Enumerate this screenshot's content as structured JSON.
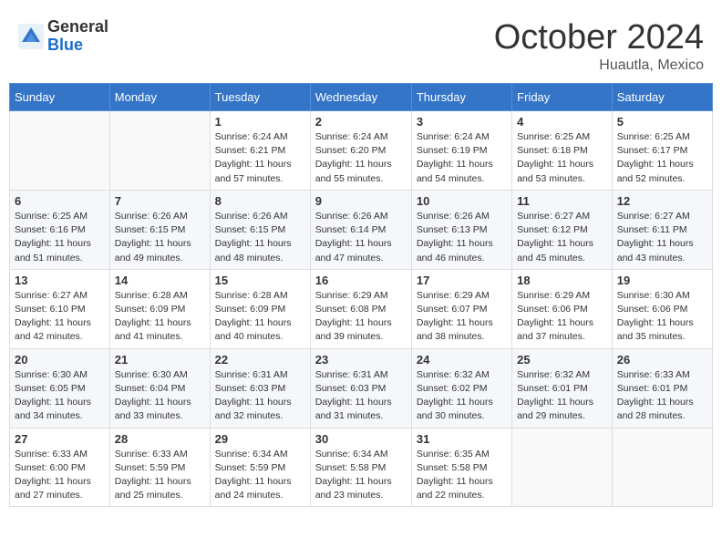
{
  "header": {
    "logo_general": "General",
    "logo_blue": "Blue",
    "month_title": "October 2024",
    "location": "Huautla, Mexico"
  },
  "weekdays": [
    "Sunday",
    "Monday",
    "Tuesday",
    "Wednesday",
    "Thursday",
    "Friday",
    "Saturday"
  ],
  "weeks": [
    [
      {
        "day": "",
        "sunrise": "",
        "sunset": "",
        "daylight": ""
      },
      {
        "day": "",
        "sunrise": "",
        "sunset": "",
        "daylight": ""
      },
      {
        "day": "1",
        "sunrise": "Sunrise: 6:24 AM",
        "sunset": "Sunset: 6:21 PM",
        "daylight": "Daylight: 11 hours and 57 minutes."
      },
      {
        "day": "2",
        "sunrise": "Sunrise: 6:24 AM",
        "sunset": "Sunset: 6:20 PM",
        "daylight": "Daylight: 11 hours and 55 minutes."
      },
      {
        "day": "3",
        "sunrise": "Sunrise: 6:24 AM",
        "sunset": "Sunset: 6:19 PM",
        "daylight": "Daylight: 11 hours and 54 minutes."
      },
      {
        "day": "4",
        "sunrise": "Sunrise: 6:25 AM",
        "sunset": "Sunset: 6:18 PM",
        "daylight": "Daylight: 11 hours and 53 minutes."
      },
      {
        "day": "5",
        "sunrise": "Sunrise: 6:25 AM",
        "sunset": "Sunset: 6:17 PM",
        "daylight": "Daylight: 11 hours and 52 minutes."
      }
    ],
    [
      {
        "day": "6",
        "sunrise": "Sunrise: 6:25 AM",
        "sunset": "Sunset: 6:16 PM",
        "daylight": "Daylight: 11 hours and 51 minutes."
      },
      {
        "day": "7",
        "sunrise": "Sunrise: 6:26 AM",
        "sunset": "Sunset: 6:15 PM",
        "daylight": "Daylight: 11 hours and 49 minutes."
      },
      {
        "day": "8",
        "sunrise": "Sunrise: 6:26 AM",
        "sunset": "Sunset: 6:15 PM",
        "daylight": "Daylight: 11 hours and 48 minutes."
      },
      {
        "day": "9",
        "sunrise": "Sunrise: 6:26 AM",
        "sunset": "Sunset: 6:14 PM",
        "daylight": "Daylight: 11 hours and 47 minutes."
      },
      {
        "day": "10",
        "sunrise": "Sunrise: 6:26 AM",
        "sunset": "Sunset: 6:13 PM",
        "daylight": "Daylight: 11 hours and 46 minutes."
      },
      {
        "day": "11",
        "sunrise": "Sunrise: 6:27 AM",
        "sunset": "Sunset: 6:12 PM",
        "daylight": "Daylight: 11 hours and 45 minutes."
      },
      {
        "day": "12",
        "sunrise": "Sunrise: 6:27 AM",
        "sunset": "Sunset: 6:11 PM",
        "daylight": "Daylight: 11 hours and 43 minutes."
      }
    ],
    [
      {
        "day": "13",
        "sunrise": "Sunrise: 6:27 AM",
        "sunset": "Sunset: 6:10 PM",
        "daylight": "Daylight: 11 hours and 42 minutes."
      },
      {
        "day": "14",
        "sunrise": "Sunrise: 6:28 AM",
        "sunset": "Sunset: 6:09 PM",
        "daylight": "Daylight: 11 hours and 41 minutes."
      },
      {
        "day": "15",
        "sunrise": "Sunrise: 6:28 AM",
        "sunset": "Sunset: 6:09 PM",
        "daylight": "Daylight: 11 hours and 40 minutes."
      },
      {
        "day": "16",
        "sunrise": "Sunrise: 6:29 AM",
        "sunset": "Sunset: 6:08 PM",
        "daylight": "Daylight: 11 hours and 39 minutes."
      },
      {
        "day": "17",
        "sunrise": "Sunrise: 6:29 AM",
        "sunset": "Sunset: 6:07 PM",
        "daylight": "Daylight: 11 hours and 38 minutes."
      },
      {
        "day": "18",
        "sunrise": "Sunrise: 6:29 AM",
        "sunset": "Sunset: 6:06 PM",
        "daylight": "Daylight: 11 hours and 37 minutes."
      },
      {
        "day": "19",
        "sunrise": "Sunrise: 6:30 AM",
        "sunset": "Sunset: 6:06 PM",
        "daylight": "Daylight: 11 hours and 35 minutes."
      }
    ],
    [
      {
        "day": "20",
        "sunrise": "Sunrise: 6:30 AM",
        "sunset": "Sunset: 6:05 PM",
        "daylight": "Daylight: 11 hours and 34 minutes."
      },
      {
        "day": "21",
        "sunrise": "Sunrise: 6:30 AM",
        "sunset": "Sunset: 6:04 PM",
        "daylight": "Daylight: 11 hours and 33 minutes."
      },
      {
        "day": "22",
        "sunrise": "Sunrise: 6:31 AM",
        "sunset": "Sunset: 6:03 PM",
        "daylight": "Daylight: 11 hours and 32 minutes."
      },
      {
        "day": "23",
        "sunrise": "Sunrise: 6:31 AM",
        "sunset": "Sunset: 6:03 PM",
        "daylight": "Daylight: 11 hours and 31 minutes."
      },
      {
        "day": "24",
        "sunrise": "Sunrise: 6:32 AM",
        "sunset": "Sunset: 6:02 PM",
        "daylight": "Daylight: 11 hours and 30 minutes."
      },
      {
        "day": "25",
        "sunrise": "Sunrise: 6:32 AM",
        "sunset": "Sunset: 6:01 PM",
        "daylight": "Daylight: 11 hours and 29 minutes."
      },
      {
        "day": "26",
        "sunrise": "Sunrise: 6:33 AM",
        "sunset": "Sunset: 6:01 PM",
        "daylight": "Daylight: 11 hours and 28 minutes."
      }
    ],
    [
      {
        "day": "27",
        "sunrise": "Sunrise: 6:33 AM",
        "sunset": "Sunset: 6:00 PM",
        "daylight": "Daylight: 11 hours and 27 minutes."
      },
      {
        "day": "28",
        "sunrise": "Sunrise: 6:33 AM",
        "sunset": "Sunset: 5:59 PM",
        "daylight": "Daylight: 11 hours and 25 minutes."
      },
      {
        "day": "29",
        "sunrise": "Sunrise: 6:34 AM",
        "sunset": "Sunset: 5:59 PM",
        "daylight": "Daylight: 11 hours and 24 minutes."
      },
      {
        "day": "30",
        "sunrise": "Sunrise: 6:34 AM",
        "sunset": "Sunset: 5:58 PM",
        "daylight": "Daylight: 11 hours and 23 minutes."
      },
      {
        "day": "31",
        "sunrise": "Sunrise: 6:35 AM",
        "sunset": "Sunset: 5:58 PM",
        "daylight": "Daylight: 11 hours and 22 minutes."
      },
      {
        "day": "",
        "sunrise": "",
        "sunset": "",
        "daylight": ""
      },
      {
        "day": "",
        "sunrise": "",
        "sunset": "",
        "daylight": ""
      }
    ]
  ]
}
